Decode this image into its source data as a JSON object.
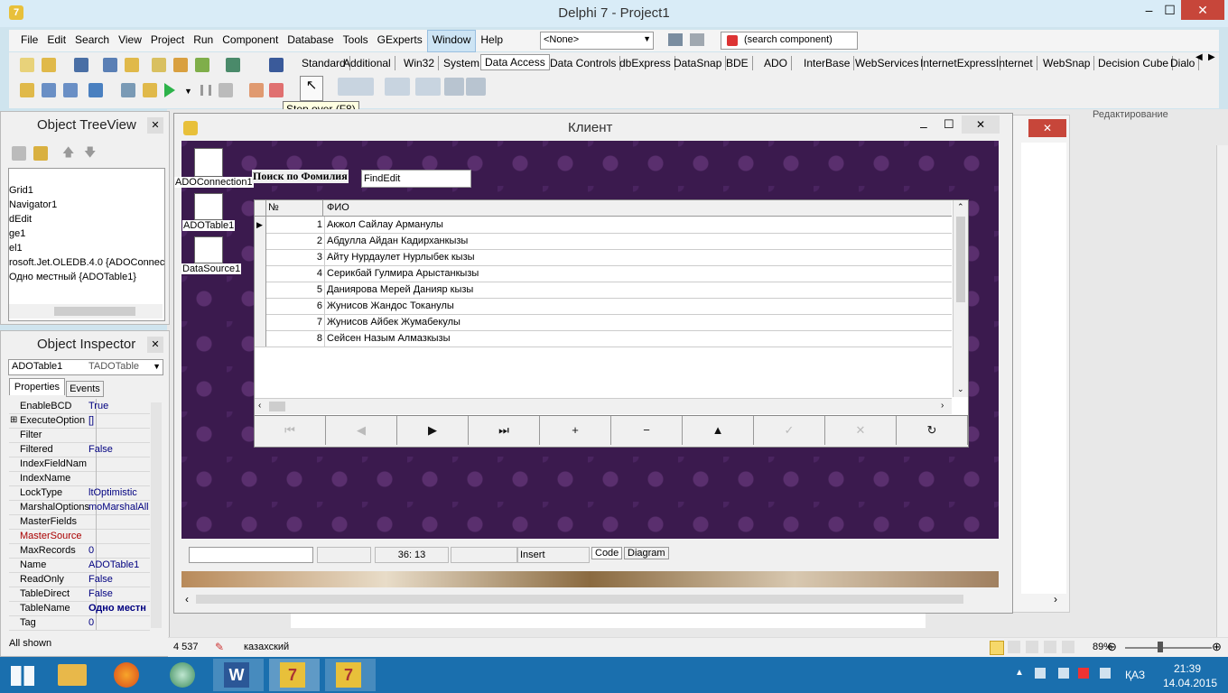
{
  "window": {
    "title": "Delphi 7 - Project1"
  },
  "menu": [
    "File",
    "Edit",
    "Search",
    "View",
    "Project",
    "Run",
    "Component",
    "Database",
    "Tools",
    "GExperts",
    "Window",
    "Help"
  ],
  "menu_active": "Window",
  "toolbar": {
    "combo_value": "<None>",
    "search_placeholder": "(search component)"
  },
  "palette_tabs": [
    "Standard",
    "Additional",
    "Win32",
    "System",
    "Data Access",
    "Data Controls",
    "dbExpress",
    "DataSnap",
    "BDE",
    "ADO",
    "InterBase",
    "WebServices",
    "InternetExpress",
    "Internet",
    "WebSnap",
    "Decision Cube",
    "Dialo"
  ],
  "palette_active": "Data Access",
  "tooltip": "Step over (F8)",
  "background_doc": {
    "ribbon_label": "Редактирование"
  },
  "treeview": {
    "title": "Object TreeView",
    "items": [
      "Grid1",
      "Navigator1",
      "dEdit",
      "ge1",
      "el1",
      "rosoft.Jet.OLEDB.4.0 {ADOConnect",
      "Одно местный {ADOTable1}"
    ]
  },
  "inspector": {
    "title": "Object Inspector",
    "object_name": "ADOTable1",
    "object_type": "TADOTable",
    "tab_properties": "Properties",
    "tab_events": "Events",
    "footer": "All shown",
    "props": [
      {
        "name": "EnableBCD",
        "value": "True"
      },
      {
        "name": "ExecuteOption",
        "value": "[]"
      },
      {
        "name": "Filter",
        "value": ""
      },
      {
        "name": "Filtered",
        "value": "False"
      },
      {
        "name": "IndexFieldNam",
        "value": ""
      },
      {
        "name": "IndexName",
        "value": ""
      },
      {
        "name": "LockType",
        "value": "ltOptimistic"
      },
      {
        "name": "MarshalOptions",
        "value": "moMarshalAll"
      },
      {
        "name": "MasterFields",
        "value": ""
      },
      {
        "name": "MasterSource",
        "value": ""
      },
      {
        "name": "MaxRecords",
        "value": "0"
      },
      {
        "name": "Name",
        "value": "ADOTable1"
      },
      {
        "name": "ReadOnly",
        "value": "False"
      },
      {
        "name": "TableDirect",
        "value": "False"
      },
      {
        "name": "TableName",
        "value": "Одно местн"
      },
      {
        "name": "Tag",
        "value": "0"
      }
    ]
  },
  "form": {
    "title": "Клиент",
    "comp_connection": "ADOConnection1",
    "comp_table": "ADOTable1",
    "comp_datasource": "DataSource1",
    "search_label": "Поиск по Фомилия",
    "find_edit": "FindEdit",
    "grid_headers": {
      "num": "№",
      "fio": "ФИО"
    },
    "rows": [
      {
        "num": "1",
        "fio": "Акжол Сайлау  Арманулы"
      },
      {
        "num": "2",
        "fio": "Абдулла Айдан Кадирханкызы"
      },
      {
        "num": "3",
        "fio": "Айту Нурдаулет Нурлыбек кызы"
      },
      {
        "num": "4",
        "fio": "Серикбай Гулмира Арыстанкызы"
      },
      {
        "num": "5",
        "fio": "Даниярова Мерей Данияр кызы"
      },
      {
        "num": "6",
        "fio": "Жунисов Жандос Токанулы"
      },
      {
        "num": "7",
        "fio": "Жунисов Айбек Жумабекулы"
      },
      {
        "num": "8",
        "fio": "Сейсен Назым Алмазкызы"
      }
    ],
    "nav_buttons": [
      "⏮",
      "◀",
      "▶",
      "⏭",
      "+",
      "−",
      "▲",
      "✓",
      "✕",
      "↻"
    ]
  },
  "editor_status": {
    "position": "36: 13",
    "mode": "Insert",
    "tab_code": "Code",
    "tab_diagram": "Diagram"
  },
  "word_status": {
    "words": "4 537",
    "language": "казахский",
    "zoom": "89%"
  },
  "taskbar": {
    "lang": "ҚАЗ",
    "time": "21:39",
    "date": "14.04.2015"
  }
}
